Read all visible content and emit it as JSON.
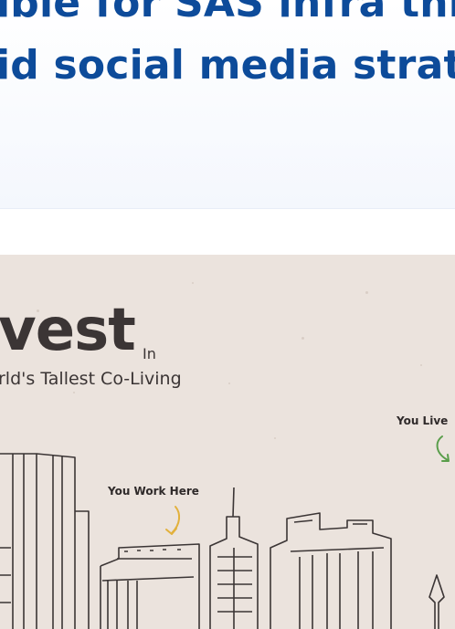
{
  "hero": {
    "headline_line1": "ible for SAS infra throu",
    "headline_line2": "id social media strate"
  },
  "banner": {
    "title": "vest",
    "title_suffix": "In",
    "subtitle": "rld's Tallest Co-Living",
    "callout_work": "You Work Here",
    "callout_live": "You Live"
  },
  "colors": {
    "headline": "#0d4b9a",
    "banner_bg": "#ebe3dd",
    "ink": "#3b3535",
    "arrow_work": "#e2b13c",
    "arrow_live": "#5a9e4b"
  }
}
